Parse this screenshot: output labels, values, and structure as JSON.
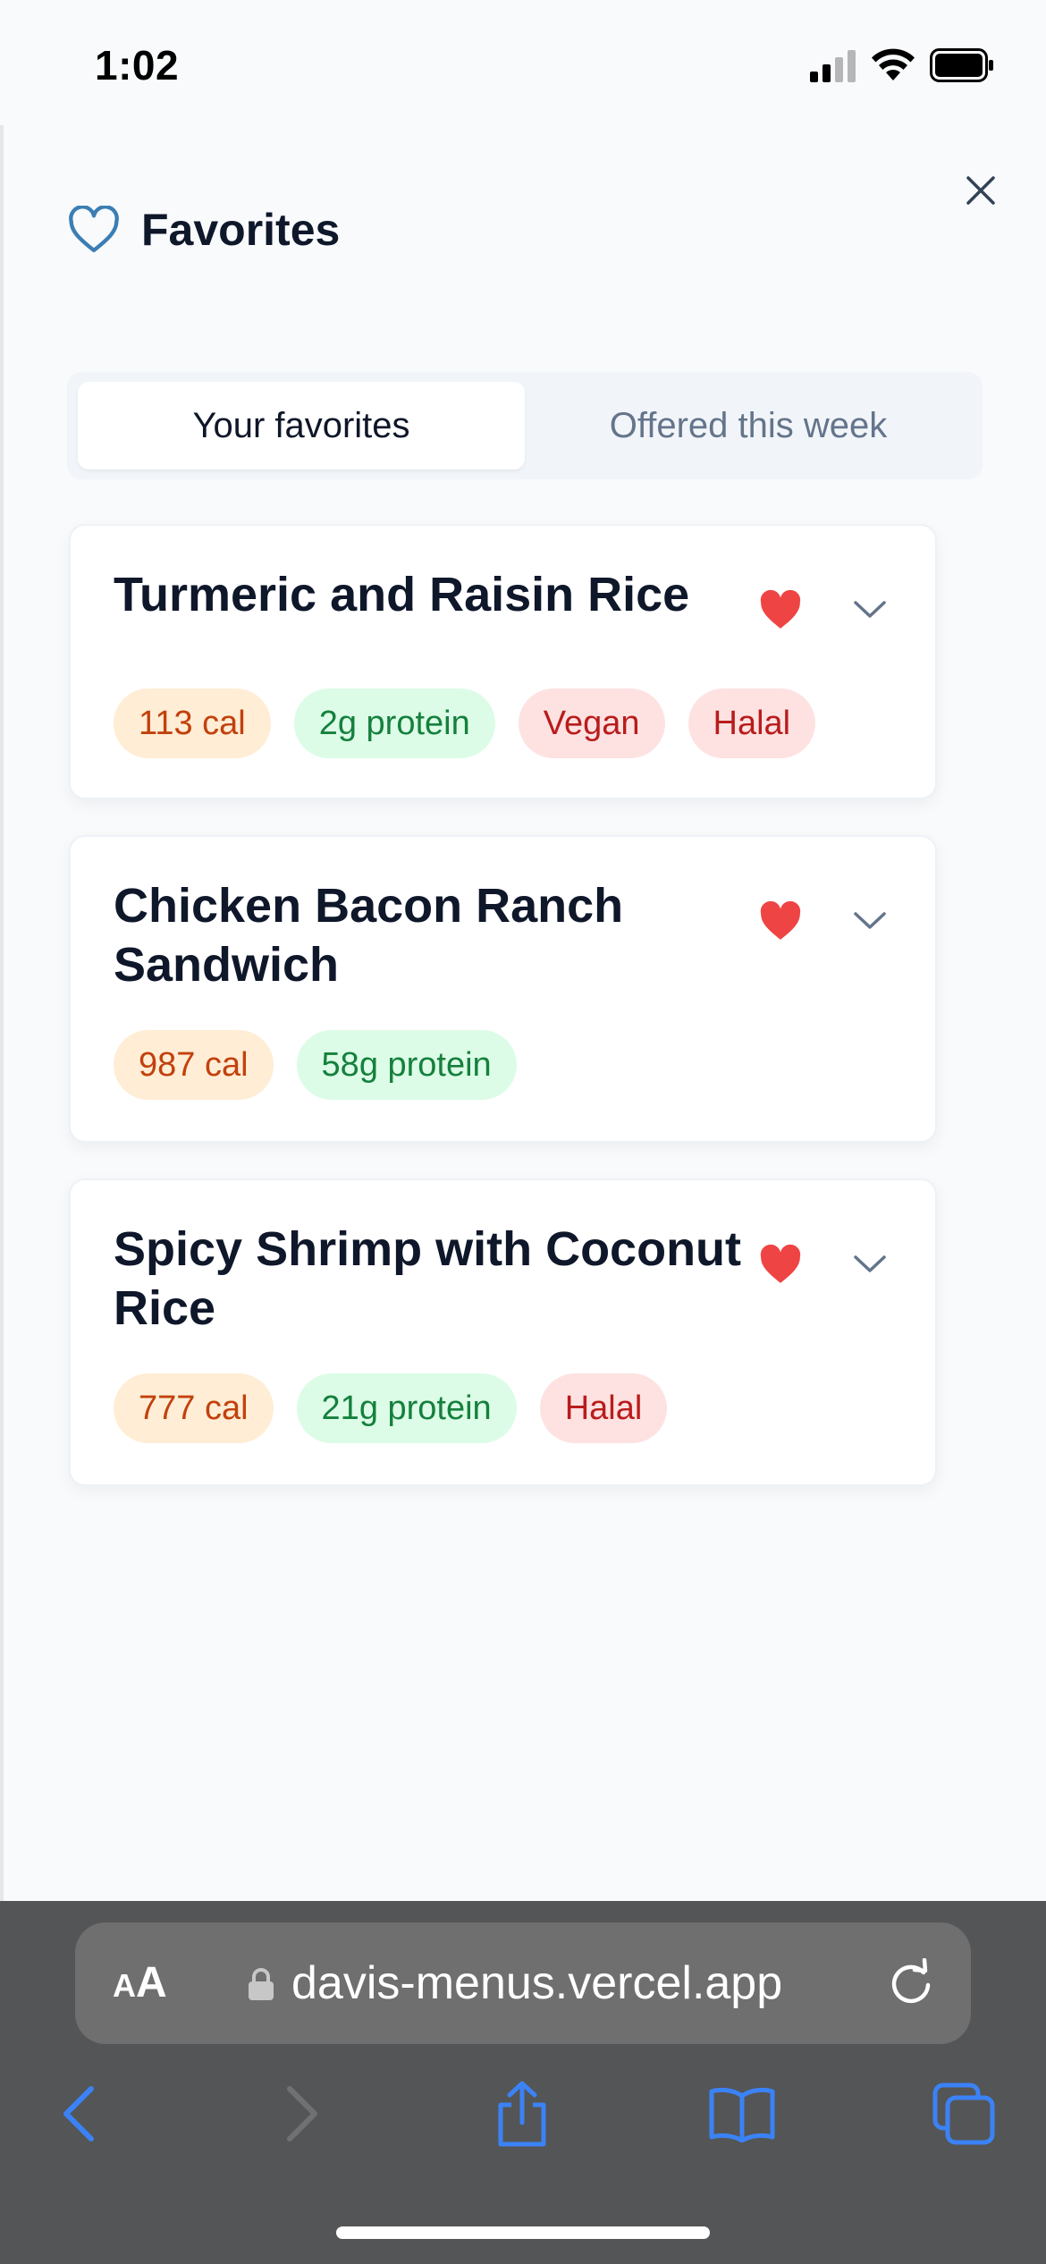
{
  "status_bar": {
    "time": "1:02"
  },
  "header": {
    "title": "Favorites"
  },
  "tabs": [
    {
      "label": "Your favorites",
      "active": true
    },
    {
      "label": "Offered this week",
      "active": false
    }
  ],
  "favorites": [
    {
      "name": "Turmeric and Raisin Rice",
      "calories": "113 cal",
      "protein": "2g protein",
      "tags": [
        "Vegan",
        "Halal"
      ]
    },
    {
      "name": "Chicken Bacon Ranch Sandwich",
      "calories": "987 cal",
      "protein": "58g protein",
      "tags": []
    },
    {
      "name": "Spicy Shrimp with Coconut Rice",
      "calories": "777 cal",
      "protein": "21g protein",
      "tags": [
        "Halal"
      ]
    }
  ],
  "browser": {
    "text_size_small": "A",
    "text_size_large": "A",
    "url": "davis-menus.vercel.app"
  },
  "colors": {
    "accent_blue": "#3b82f6",
    "heart_red": "#ef4444",
    "calorie_bg": "#ffedd5",
    "protein_bg": "#dcfce7",
    "diet_bg": "#fee2e2"
  },
  "icons": [
    "heart-outline-icon",
    "close-icon",
    "heart-filled-icon",
    "chevron-down-icon",
    "lock-icon",
    "reload-icon",
    "back-icon",
    "forward-icon",
    "share-icon",
    "bookmarks-icon",
    "tabs-icon"
  ]
}
